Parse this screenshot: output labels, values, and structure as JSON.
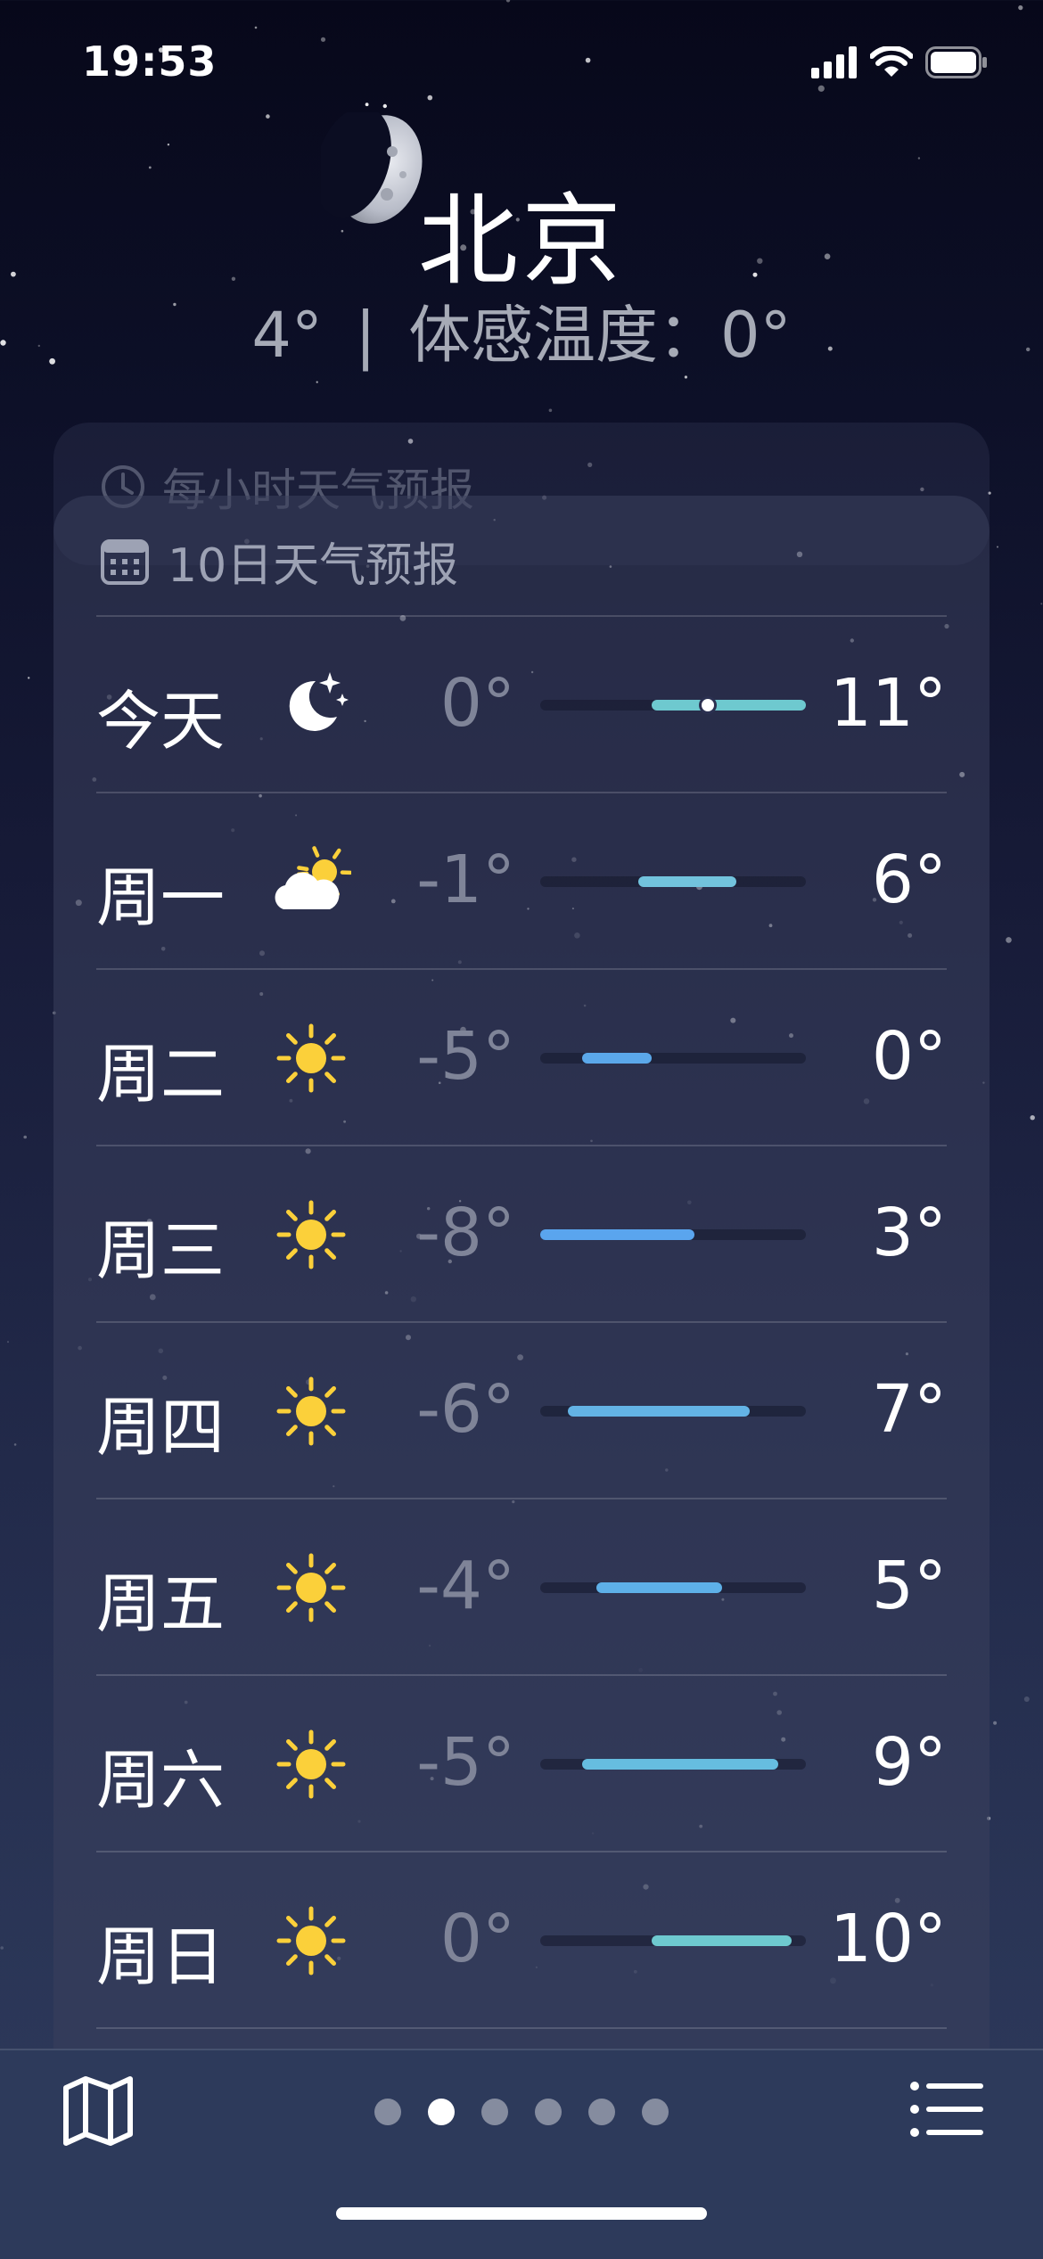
{
  "status_bar": {
    "time": "19:53"
  },
  "location": {
    "city": "北京",
    "current_temp": "4°",
    "separator": "|",
    "feels_like": "体感温度：0°"
  },
  "hourly_card": {
    "title": "每小时天气预报"
  },
  "forecast": {
    "title": "10日天气预报",
    "scale_min": -8,
    "scale_max": 11,
    "current_temperature": 4,
    "days": [
      {
        "day": "今天",
        "icon": "moon-stars-icon",
        "low": "0°",
        "high": "11°",
        "low_value": 0,
        "high_value": 11,
        "bar_color": "#6ec9cf",
        "current": true
      },
      {
        "day": "周一",
        "icon": "cloud-sun-icon",
        "low": "-1°",
        "high": "6°",
        "low_value": -1,
        "high_value": 6,
        "bar_color": "#72c3dd"
      },
      {
        "day": "周二",
        "icon": "sun-icon",
        "low": "-5°",
        "high": "0°",
        "low_value": -5,
        "high_value": 0,
        "bar_color": "#5ba8ea"
      },
      {
        "day": "周三",
        "icon": "sun-icon",
        "low": "-8°",
        "high": "3°",
        "low_value": -8,
        "high_value": 3,
        "bar_color": "#5aa5ee"
      },
      {
        "day": "周四",
        "icon": "sun-icon",
        "low": "-6°",
        "high": "7°",
        "low_value": -6,
        "high_value": 7,
        "bar_color": "#63b3e5"
      },
      {
        "day": "周五",
        "icon": "sun-icon",
        "low": "-4°",
        "high": "5°",
        "low_value": -4,
        "high_value": 5,
        "bar_color": "#5eb0e8"
      },
      {
        "day": "周六",
        "icon": "sun-icon",
        "low": "-5°",
        "high": "9°",
        "low_value": -5,
        "high_value": 9,
        "bar_color": "#66bde0"
      },
      {
        "day": "周日",
        "icon": "sun-icon",
        "low": "0°",
        "high": "10°",
        "low_value": 0,
        "high_value": 10,
        "bar_color": "#6ec9cf"
      }
    ]
  },
  "toolbar": {
    "page_count": 6,
    "active_page": 2
  },
  "colors": {
    "sun": "#fbd03a",
    "background_top": "#07081a",
    "background_bottom": "#2e3a5c",
    "toolbar": "#2d3a5b"
  }
}
